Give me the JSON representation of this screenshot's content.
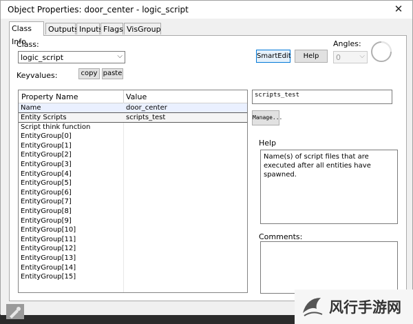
{
  "window": {
    "title": "Object Properties: door_center - logic_script",
    "close_label": "✕"
  },
  "tabs": [
    {
      "label": "Class Info"
    },
    {
      "label": "Outputs"
    },
    {
      "label": "Inputs"
    },
    {
      "label": "Flags"
    },
    {
      "label": "VisGroup"
    }
  ],
  "class_info": {
    "class_label": "Class:",
    "class_value": "logic_script",
    "smartedit_label": "SmartEdit",
    "help_button_label": "Help",
    "angles_label": "Angles:",
    "angles_value": "0",
    "keyvalues_label": "Keyvalues:",
    "copy_label": "copy",
    "paste_label": "paste"
  },
  "properties": {
    "columns": [
      "Property Name",
      "Value"
    ],
    "rows": [
      {
        "name": "Name",
        "value": "door_center"
      },
      {
        "name": "Entity Scripts",
        "value": "scripts_test"
      },
      {
        "name": "Script think function",
        "value": ""
      },
      {
        "name": "EntityGroup[0]",
        "value": ""
      },
      {
        "name": "EntityGroup[1]",
        "value": ""
      },
      {
        "name": "EntityGroup[2]",
        "value": ""
      },
      {
        "name": "EntityGroup[3]",
        "value": ""
      },
      {
        "name": "EntityGroup[4]",
        "value": ""
      },
      {
        "name": "EntityGroup[5]",
        "value": ""
      },
      {
        "name": "EntityGroup[6]",
        "value": ""
      },
      {
        "name": "EntityGroup[7]",
        "value": ""
      },
      {
        "name": "EntityGroup[8]",
        "value": ""
      },
      {
        "name": "EntityGroup[9]",
        "value": ""
      },
      {
        "name": "EntityGroup[10]",
        "value": ""
      },
      {
        "name": "EntityGroup[11]",
        "value": ""
      },
      {
        "name": "EntityGroup[12]",
        "value": ""
      },
      {
        "name": "EntityGroup[13]",
        "value": ""
      },
      {
        "name": "EntityGroup[14]",
        "value": ""
      },
      {
        "name": "EntityGroup[15]",
        "value": ""
      }
    ]
  },
  "editor": {
    "value_text": "scripts_test",
    "manage_label": "Manage...",
    "help_label": "Help",
    "help_text": "Name(s) of script files that are executed after all entities have spawned.",
    "comments_label": "Comments:",
    "comments_text": ""
  },
  "watermark": {
    "text": "风行手游网"
  }
}
